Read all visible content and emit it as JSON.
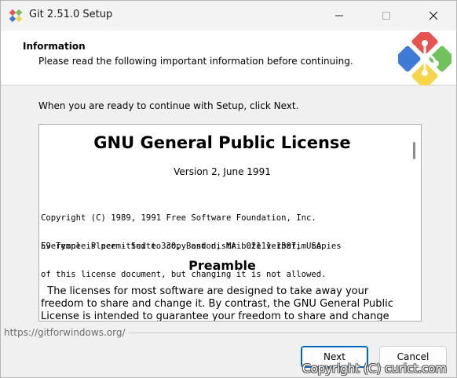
{
  "window": {
    "title": "Git 2.51.0 Setup",
    "icon": "git-logo-icon"
  },
  "header": {
    "title": "Information",
    "subtitle": "Please read the following important information before continuing."
  },
  "body": {
    "intro": "When you are ready to continue with Setup, click Next."
  },
  "license": {
    "title": "GNU General Public License",
    "version": "Version 2, June 1991",
    "copyright_lines": [
      "Copyright (C) 1989, 1991 Free Software Foundation, Inc.",
      "59 Temple Place - Suite 330, Boston, MA  02111-1307, USA"
    ],
    "permission_lines": [
      "Everyone is permitted to copy and distribute verbatim copies",
      "of this license document, but changing it is not allowed."
    ],
    "preamble_title": "Preamble",
    "preamble_lines": [
      "  The licenses for most software are designed to take away your",
      "freedom to share and change it. By contrast, the GNU General Public",
      "License is intended to guarantee your freedom to share and change"
    ]
  },
  "footer": {
    "brand": "https://gitforwindows.org/",
    "next_label": "Next",
    "cancel_label": "Cancel"
  },
  "overlay": {
    "copyright": "Copyright (C) curict.com"
  },
  "colors": {
    "accent": "#0067c0",
    "logo_red": "#e8524f",
    "logo_green": "#70c25a",
    "logo_blue": "#3e7bd8",
    "logo_yellow": "#f6d54b"
  }
}
